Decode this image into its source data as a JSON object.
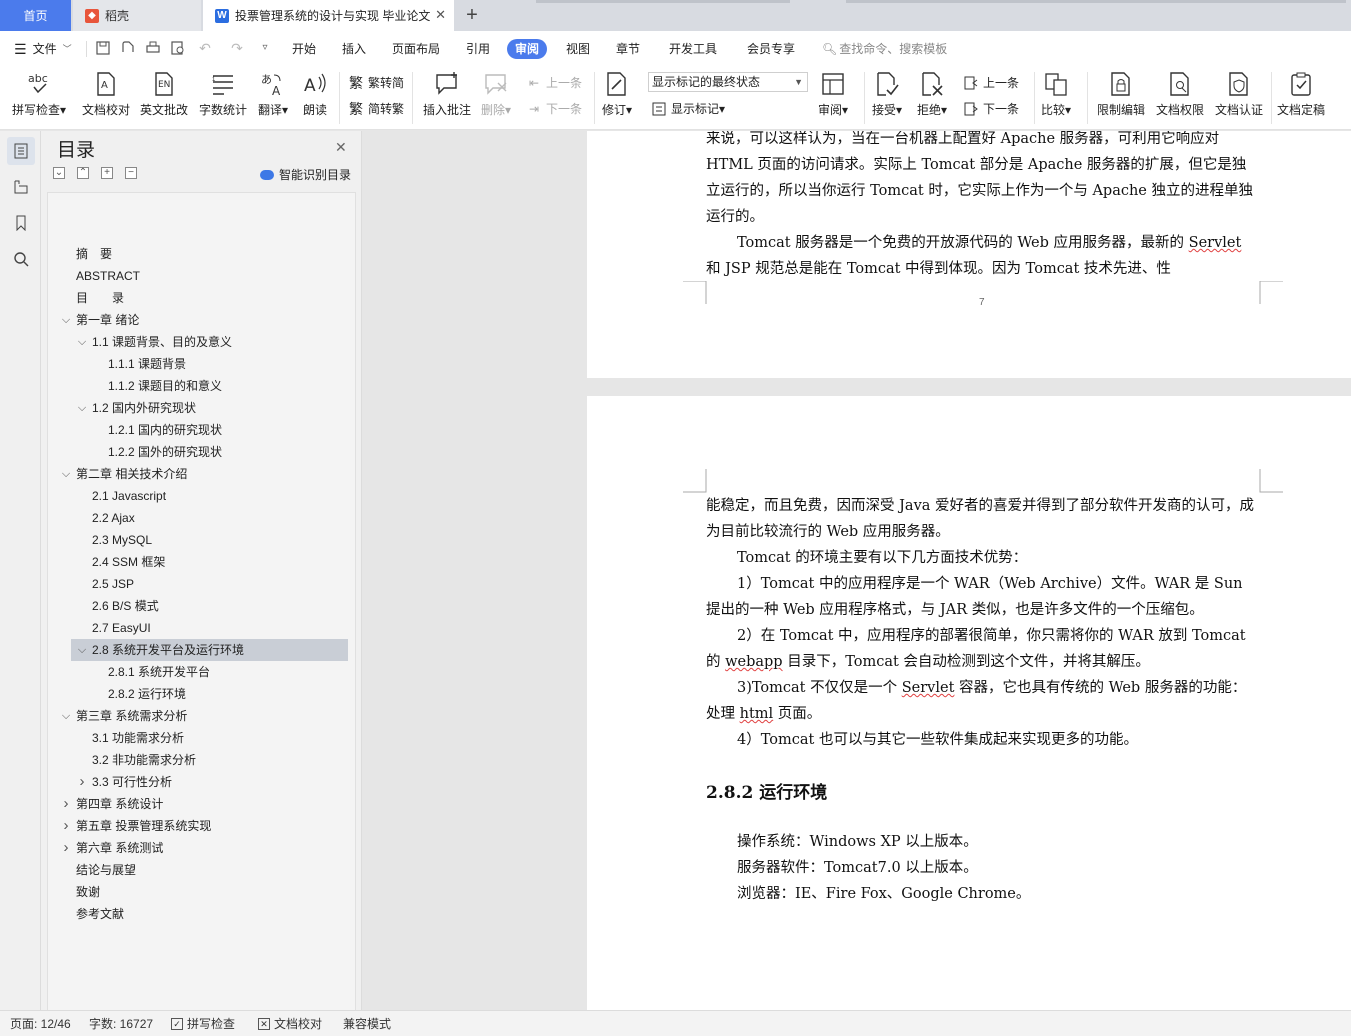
{
  "tabs": {
    "home": "首页",
    "daoke": "稻壳",
    "document": "投票管理系统的设计与实现 毕业论文"
  },
  "menu": {
    "file": "文件",
    "items": [
      "开始",
      "插入",
      "页面布局",
      "引用",
      "审阅",
      "视图",
      "章节",
      "开发工具",
      "会员专享"
    ],
    "active": "审阅",
    "search_placeholder": "查找命令、搜索模板"
  },
  "ribbon": {
    "spell_check": "拼写检查",
    "doc_proof": "文档校对",
    "english_review": "英文批改",
    "word_count": "字数统计",
    "translate": "翻译",
    "read_aloud": "朗读",
    "trad_to_simp": "繁转简",
    "simp_to_trad": "简转繁",
    "insert_comment": "插入批注",
    "delete": "删除",
    "prev_comment": "上一条",
    "next_comment": "下一条",
    "track_changes": "修订",
    "markup_state": "显示标记的最终状态",
    "show_markup": "显示标记",
    "review_pane": "审阅",
    "accept": "接受",
    "reject": "拒绝",
    "prev_change": "上一条",
    "next_change": "下一条",
    "compare": "比较",
    "restrict_edit": "限制编辑",
    "doc_permission": "文档权限",
    "doc_certify": "文档认证",
    "doc_finalize": "文档定稿"
  },
  "toc": {
    "title": "目录",
    "smart_button": "智能识别目录",
    "items": [
      {
        "label": "摘　要",
        "level": 0,
        "toggle": ""
      },
      {
        "label": "ABSTRACT",
        "level": 0,
        "toggle": ""
      },
      {
        "label": "目　　录",
        "level": 0,
        "toggle": ""
      },
      {
        "label": "第一章  绪论",
        "level": 0,
        "toggle": "v"
      },
      {
        "label": "1.1  课题背景、目的及意义",
        "level": 1,
        "toggle": "v"
      },
      {
        "label": "1.1.1  课题背景",
        "level": 2,
        "toggle": ""
      },
      {
        "label": "1.1.2  课题目的和意义",
        "level": 2,
        "toggle": ""
      },
      {
        "label": "1.2  国内外研究现状",
        "level": 1,
        "toggle": "v"
      },
      {
        "label": "1.2.1  国内的研究现状",
        "level": 2,
        "toggle": ""
      },
      {
        "label": "1.2.2  国外的研究现状",
        "level": 2,
        "toggle": ""
      },
      {
        "label": "第二章  相关技术介绍",
        "level": 0,
        "toggle": "v"
      },
      {
        "label": "2.1 Javascript",
        "level": 1,
        "toggle": ""
      },
      {
        "label": "2.2 Ajax",
        "level": 1,
        "toggle": ""
      },
      {
        "label": "2.3 MySQL",
        "level": 1,
        "toggle": ""
      },
      {
        "label": "2.4 SSM 框架",
        "level": 1,
        "toggle": ""
      },
      {
        "label": "2.5 JSP",
        "level": 1,
        "toggle": ""
      },
      {
        "label": "2.6 B/S 模式",
        "level": 1,
        "toggle": ""
      },
      {
        "label": "2.7 EasyUI",
        "level": 1,
        "toggle": ""
      },
      {
        "label": "2.8  系统开发平台及运行环境",
        "level": 1,
        "toggle": "v",
        "selected": true
      },
      {
        "label": "2.8.1  系统开发平台",
        "level": 2,
        "toggle": ""
      },
      {
        "label": "2.8.2  运行环境",
        "level": 2,
        "toggle": ""
      },
      {
        "label": "第三章  系统需求分析",
        "level": 0,
        "toggle": "v"
      },
      {
        "label": "3.1  功能需求分析",
        "level": 1,
        "toggle": ""
      },
      {
        "label": "3.2  非功能需求分析",
        "level": 1,
        "toggle": ""
      },
      {
        "label": "3.3  可行性分析",
        "level": 1,
        "toggle": ">"
      },
      {
        "label": "第四章  系统设计",
        "level": 0,
        "toggle": ">"
      },
      {
        "label": "第五章  投票管理系统实现",
        "level": 0,
        "toggle": ">"
      },
      {
        "label": "第六章  系统测试",
        "level": 0,
        "toggle": ">"
      },
      {
        "label": "结论与展望",
        "level": 0,
        "toggle": ""
      },
      {
        "label": "致谢",
        "level": 0,
        "toggle": ""
      },
      {
        "label": "参考文献",
        "level": 0,
        "toggle": ""
      }
    ]
  },
  "document": {
    "page1": {
      "line0": "来说，可以这样认为，当在一台机器上配置好 Apache 服务器，可利用它响应对",
      "para1_rest": "HTML 页面的访问请求。实际上 Tomcat 部分是 Apache 服务器的扩展，但它是独立运行的，所以当你运行 Tomcat 时，它实际上作为一个与 Apache 独立的进程单独运行的。",
      "para2_a": "Tomcat 服务器是一个免费的开放源代码的 Web 应用服务器，最新的 ",
      "para2_servlet": "Servlet",
      "para2_b": " 和 JSP 规范总是能在 Tomcat 中得到体现。因为 Tomcat 技术先进、性",
      "page_number": "7"
    },
    "page2": {
      "p1": "能稳定，而且免费，因而深受 Java 爱好者的喜爱并得到了部分软件开发商的认可，成为目前比较流行的 Web 应用服务器。",
      "p2": "Tomcat 的环境主要有以下几方面技术优势：",
      "p3": "1）Tomcat 中的应用程序是一个 WAR（Web Archive）文件。WAR 是 Sun 提出的一种 Web 应用程序格式，与 JAR 类似，也是许多文件的一个压缩包。",
      "p4_a": "2）在 Tomcat 中，应用程序的部署很简单，你只需将你的 WAR 放到 Tomcat 的 ",
      "p4_webapp": "webapp",
      "p4_b": " 目录下，Tomcat 会自动检测到这个文件，并将其解压。",
      "p5_a": "3)Tomcat 不仅仅是一个 ",
      "p5_servlet": "Servlet",
      "p5_b": " 容器，它也具有传统的 Web 服务器的功能：处理 ",
      "p5_html": "html",
      "p5_c": " 页面。",
      "p6": "4）Tomcat 也可以与其它一些软件集成起来实现更多的功能。",
      "heading": "2.8.2  运行环境",
      "env1": "操作系统：Windows XP 以上版本。",
      "env2": "服务器软件：Tomcat7.0 以上版本。",
      "env3": "浏览器：IE、Fire Fox、Google Chrome。"
    }
  },
  "status": {
    "page": "页面: 12/46",
    "words": "字数: 16727",
    "spell": "拼写检查",
    "proof": "文档校对",
    "compat": "兼容模式"
  },
  "colors": {
    "accent": "#4b7bec",
    "spell_underline": "#e04040"
  }
}
